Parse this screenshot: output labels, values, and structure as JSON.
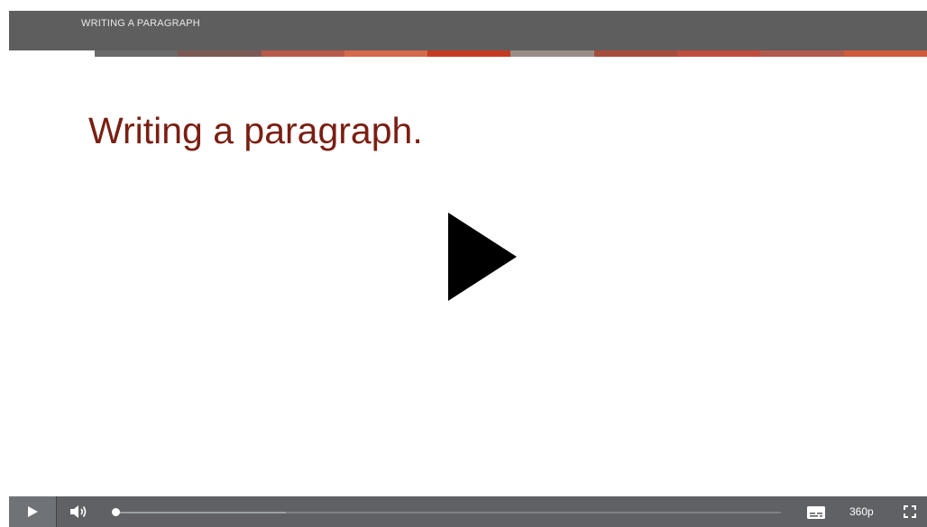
{
  "header": {
    "title": "WRITING A PARAGRAPH",
    "stripe_colors": [
      "#6a6a6a",
      "#7b5a55",
      "#b85a48",
      "#d56a4a",
      "#c63a22",
      "#9a8e88",
      "#a84c3c",
      "#c04c3c",
      "#b35a4e",
      "#d05a3a"
    ]
  },
  "slide": {
    "title": "Writing a paragraph."
  },
  "player": {
    "big_play_icon": "play-icon",
    "controls": {
      "play_icon": "play-icon",
      "volume_icon": "volume-icon",
      "progress_fraction": 0.002,
      "buffered_fraction": 0.26,
      "captions_icon": "captions-icon",
      "quality_label": "360p",
      "fullscreen_icon": "fullscreen-icon"
    }
  },
  "colors": {
    "title_color": "#7a1f12",
    "topbar_bg": "#5e5e5e",
    "controls_bg": "#5f6165"
  }
}
